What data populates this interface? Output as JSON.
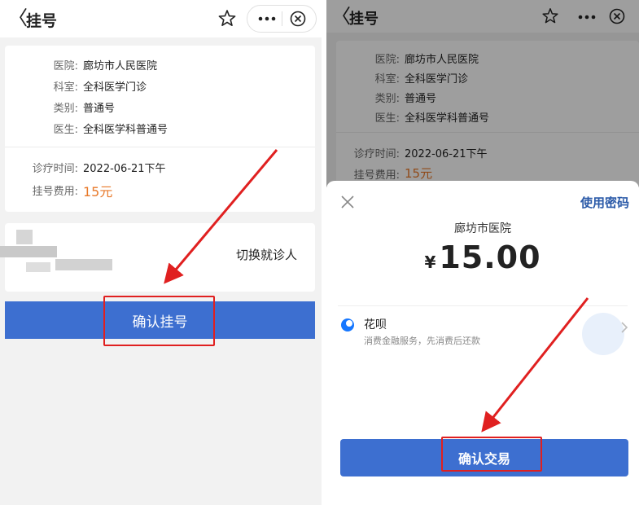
{
  "left": {
    "nav": {
      "back_glyph": "〈",
      "title": "挂号",
      "star_icon": "star-outline-icon",
      "more_icon": "more-dots-icon",
      "close_icon": "close-circle-icon"
    },
    "info": {
      "hospital_label": "医院:",
      "hospital_value": "廊坊市人民医院",
      "dept_label": "科室:",
      "dept_value": "全科医学门诊",
      "type_label": "类别:",
      "type_value": "普通号",
      "doctor_label": "医生:",
      "doctor_value": "全科医学科普通号",
      "time_label": "诊疗时间:",
      "time_value": "2022-06-21下午",
      "fee_label": "挂号费用:",
      "fee_value": "15元"
    },
    "patient": {
      "switch_label": "切换就诊人"
    },
    "confirm_button": "确认挂号"
  },
  "right": {
    "nav": {
      "back_glyph": "〈",
      "title": "挂号"
    },
    "info": {
      "hospital_label": "医院:",
      "hospital_value": "廊坊市人民医院",
      "dept_label": "科室:",
      "dept_value": "全科医学门诊",
      "type_label": "类别:",
      "type_value": "普通号",
      "doctor_label": "医生:",
      "doctor_value": "全科医学科普通号",
      "time_label": "诊疗时间:",
      "time_value": "2022-06-21下午",
      "fee_label": "挂号费用:",
      "fee_value": "15元"
    },
    "sheet": {
      "use_password": "使用密码",
      "merchant": "廊坊市医院",
      "currency": "¥",
      "amount": "15.00",
      "method_name": "花呗",
      "method_desc": "消费金融服务，先消费后还款",
      "confirm_button": "确认交易"
    }
  },
  "colors": {
    "primary_blue": "#3d6fd0",
    "highlight_red": "#e02020",
    "fee_orange": "#e8792a",
    "link_blue": "#2b5aa8"
  }
}
